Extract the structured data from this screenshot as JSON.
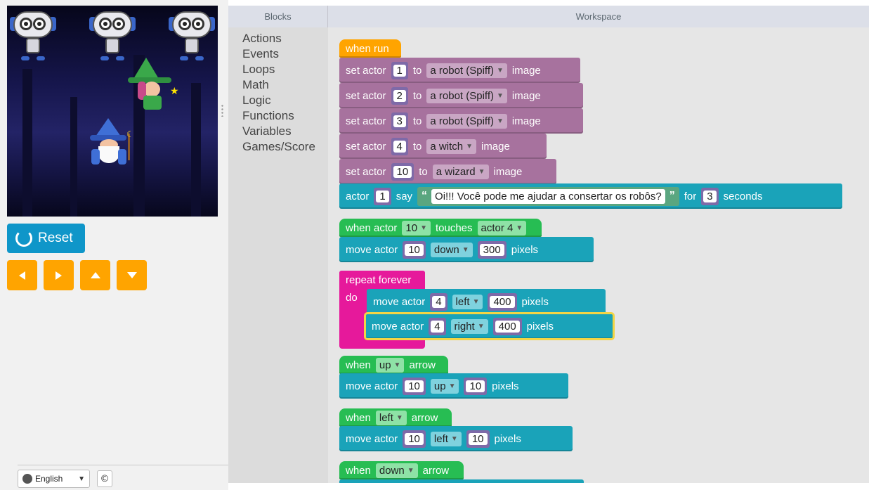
{
  "toolbox": {
    "header": "Blocks",
    "categories": [
      "Actions",
      "Events",
      "Loops",
      "Math",
      "Logic",
      "Functions",
      "Variables",
      "Games/Score"
    ]
  },
  "workspace": {
    "header": "Workspace",
    "when_run": "when run",
    "set_actor_rows": [
      {
        "label": "set actor",
        "num": "1",
        "to": "to",
        "value": "a robot (Spiff)",
        "suffix": "image"
      },
      {
        "label": "set actor",
        "num": "2",
        "to": "to",
        "value": "a robot (Spiff)",
        "suffix": "image"
      },
      {
        "label": "set actor",
        "num": "3",
        "to": "to",
        "value": "a robot (Spiff)",
        "suffix": "image"
      },
      {
        "label": "set actor",
        "num": "4",
        "to": "to",
        "value": "a witch",
        "suffix": "image"
      },
      {
        "label": "set actor",
        "num": "10",
        "to": "to",
        "value": "a wizard",
        "suffix": "image"
      }
    ],
    "say": {
      "label": "actor",
      "num": "1",
      "say": "say",
      "text": "Oi!!! Você pode me ajudar a consertar os robôs?",
      "for": "for",
      "secs": "3",
      "unit": "seconds"
    },
    "touch": {
      "when_actor": "when actor",
      "a": "10",
      "touches": "touches",
      "b": "actor 4"
    },
    "touch_move": {
      "label": "move actor",
      "num": "10",
      "dir": "down",
      "dist": "300",
      "unit": "pixels"
    },
    "repeat": {
      "label": "repeat forever",
      "do": "do"
    },
    "repeat_moves": [
      {
        "label": "move actor",
        "num": "4",
        "dir": "left",
        "dist": "400",
        "unit": "pixels"
      },
      {
        "label": "move actor",
        "num": "4",
        "dir": "right",
        "dist": "400",
        "unit": "pixels"
      }
    ],
    "arrow_events": [
      {
        "when": "when",
        "key": "up",
        "arrow": "arrow",
        "move": {
          "label": "move actor",
          "num": "10",
          "dir": "up",
          "dist": "10",
          "unit": "pixels"
        }
      },
      {
        "when": "when",
        "key": "left",
        "arrow": "arrow",
        "move": {
          "label": "move actor",
          "num": "10",
          "dir": "left",
          "dist": "10",
          "unit": "pixels"
        }
      },
      {
        "when": "when",
        "key": "down",
        "arrow": "arrow"
      }
    ]
  },
  "controls": {
    "reset": "Reset"
  },
  "footer": {
    "language": "English",
    "copyright": "©"
  },
  "colors": {
    "sprite": "#a7729e",
    "say": "#1aa3b9",
    "event": "#27bd53",
    "run": "#ffa400",
    "loop": "#e6199b",
    "reset": "#0f96c9",
    "arrows": "#ffa400"
  },
  "icons": {
    "reset": "reset-icon",
    "left": "arrow-left-icon",
    "right": "arrow-right-icon",
    "up": "arrow-up-icon",
    "down": "arrow-down-icon",
    "language": "globe-icon"
  }
}
